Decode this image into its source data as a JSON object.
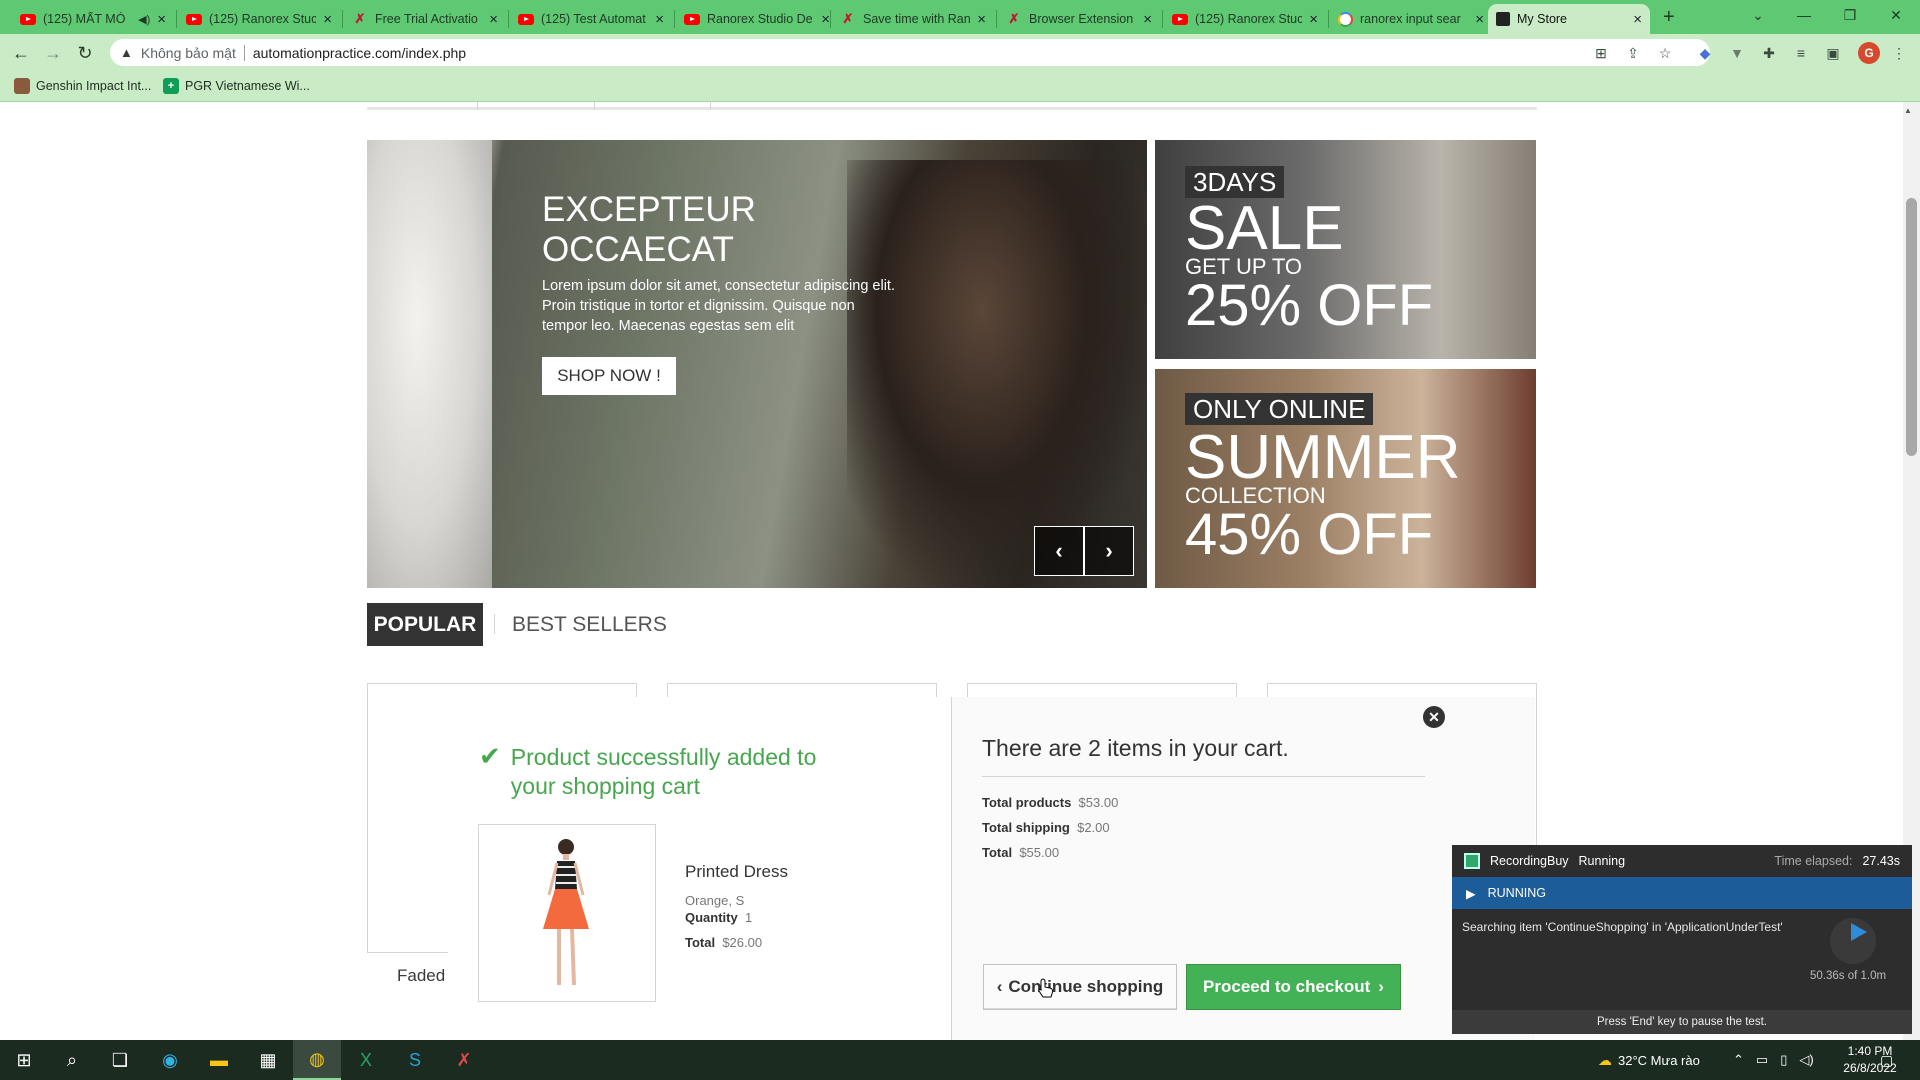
{
  "browser": {
    "tabs": [
      {
        "title": "(125) MẤT MÓ",
        "icon": "youtube"
      },
      {
        "title": "(125) Ranorex Stuc",
        "icon": "youtube"
      },
      {
        "title": "Free Trial Activatio",
        "icon": "ranorex"
      },
      {
        "title": "(125) Test Automat",
        "icon": "youtube"
      },
      {
        "title": "Ranorex Studio De",
        "icon": "youtube"
      },
      {
        "title": "Save time with Ran",
        "icon": "ranorex"
      },
      {
        "title": "Browser Extension",
        "icon": "ranorex"
      },
      {
        "title": "(125) Ranorex Stuc",
        "icon": "youtube"
      },
      {
        "title": "ranorex input sear",
        "icon": "google"
      },
      {
        "title": "My Store",
        "icon": "store",
        "active": true
      }
    ],
    "new_tab": "+",
    "security_label": "Không bảo mật",
    "url": "automationpractice.com/index.php",
    "profile_initial": "G",
    "bookmarks": [
      {
        "label": "Genshin Impact Int..."
      },
      {
        "label": "PGR Vietnamese Wi..."
      }
    ]
  },
  "slider": {
    "title_line1": "EXCEPTEUR",
    "title_line2": "OCCAECAT",
    "description": "Lorem ipsum dolor sit amet, consectetur adipiscing elit. Proin tristique in tortor et dignissim. Quisque non tempor leo. Maecenas egestas sem elit",
    "button": "SHOP NOW !",
    "prev": "‹",
    "next": "›"
  },
  "banners": [
    {
      "tag": "3DAYS",
      "big": "SALE",
      "small": "GET UP TO",
      "offer": "25% OFF"
    },
    {
      "tag": "ONLY ONLINE",
      "big": "SUMMER",
      "small": "COLLECTION",
      "offer": "45% OFF"
    }
  ],
  "product_tabs": {
    "popular": "POPULAR",
    "best_sellers": "BEST SELLERS"
  },
  "listing": {
    "partial_name": "Faded"
  },
  "layer_cart": {
    "success_message": "Product successfully added to your shopping cart",
    "product_name": "Printed Dress",
    "attributes": "Orange, S",
    "quantity_label": "Quantity",
    "quantity": "1",
    "total_label": "Total",
    "total": "$26.00",
    "cart_count_text": "There are 2 items in your cart.",
    "total_products_label": "Total products",
    "total_products": "$53.00",
    "total_shipping_label": "Total shipping",
    "total_shipping": "$2.00",
    "grand_total_label": "Total",
    "grand_total": "$55.00",
    "continue_button": "Continue shopping",
    "checkout_button": "Proceed to checkout"
  },
  "ranorex_panel": {
    "name": "RecordingBuy",
    "state": "Running",
    "elapsed_label": "Time elapsed:",
    "elapsed": "27.43s",
    "status": "RUNNING",
    "message": "Searching item 'ContinueShopping' in 'ApplicationUnderTest'",
    "progress": "50.36s of 1.0m",
    "footer": "Press 'End' key to pause the test."
  },
  "taskbar": {
    "weather": "32°C  Mưa rào",
    "time": "1:40 PM",
    "date": "26/8/2022"
  },
  "colors": {
    "chrome_tab_bar": "#5fc873",
    "chrome_toolbar": "#c9ecc6",
    "success_green": "#46a74e",
    "checkout_button": "#43b155",
    "ranorex_running": "#1c5d99"
  }
}
